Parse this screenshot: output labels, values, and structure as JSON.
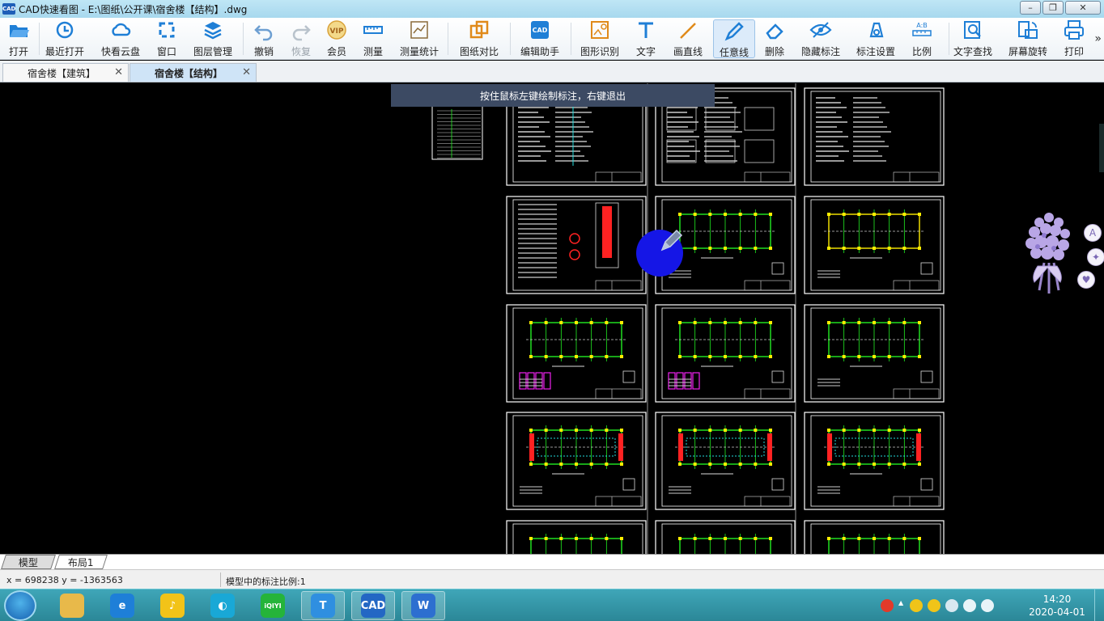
{
  "window": {
    "app_icon": "CAD",
    "title": "CAD快速看图 - E:\\图纸\\公开课\\宿舍楼【结构】.dwg",
    "controls": [
      "minimize",
      "maximize",
      "close"
    ]
  },
  "toolbar": {
    "items": [
      {
        "label": "打开",
        "icon": "folder-open-icon"
      },
      {
        "label": "最近打开",
        "icon": "recent-clock-icon"
      },
      {
        "label": "快看云盘",
        "icon": "cloud-icon"
      },
      {
        "label": "窗口",
        "icon": "window-frame-icon"
      },
      {
        "label": "图层管理",
        "icon": "layers-icon"
      },
      {
        "label": "撤销",
        "icon": "undo-icon"
      },
      {
        "label": "恢复",
        "icon": "redo-icon"
      },
      {
        "label": "会员",
        "icon": "vip-icon"
      },
      {
        "label": "测量",
        "icon": "ruler-icon"
      },
      {
        "label": "测量统计",
        "icon": "measure-stats-icon"
      },
      {
        "label": "图纸对比",
        "icon": "compare-icon"
      },
      {
        "label": "编辑助手",
        "icon": "edit-assistant-icon"
      },
      {
        "label": "图形识别",
        "icon": "shape-recognize-icon"
      },
      {
        "label": "文字",
        "icon": "text-icon"
      },
      {
        "label": "画直线",
        "icon": "line-icon"
      },
      {
        "label": "任意线",
        "icon": "freehand-pen-icon"
      },
      {
        "label": "删除",
        "icon": "eraser-icon"
      },
      {
        "label": "隐藏标注",
        "icon": "hide-eye-icon"
      },
      {
        "label": "标注设置",
        "icon": "annotation-settings-icon"
      },
      {
        "label": "比例",
        "icon": "scale-icon"
      },
      {
        "label": "文字查找",
        "icon": "text-search-icon"
      },
      {
        "label": "屏幕旋转",
        "icon": "rotate-screen-icon"
      },
      {
        "label": "打印",
        "icon": "printer-icon"
      }
    ],
    "more": "»",
    "accent": "#1f7fd6"
  },
  "tabs": [
    {
      "label": "宿舍楼【建筑】",
      "active": false
    },
    {
      "label": "宿舍楼【结构】",
      "active": true
    }
  ],
  "canvas": {
    "hint": "按住鼠标左键绘制标注，右键退出",
    "background": "#000000",
    "sheet_colors": {
      "frame": "#ffffff",
      "green": "#22ee22",
      "yellow": "#ffee00",
      "red": "#ff2222",
      "cyan": "#22dddd",
      "magenta": "#ee22ee"
    }
  },
  "side_tools": [
    "font-a-icon",
    "sparkle-icon",
    "pet-icon"
  ],
  "layout_tabs": [
    "模型",
    "布局1"
  ],
  "status": {
    "coords": "x = 698238  y = -1363563",
    "scale": "模型中的标注比例:1"
  },
  "taskbar": {
    "apps": [
      {
        "name": "file-explorer-icon",
        "glyph": "",
        "color": "#e8b94a",
        "running": false
      },
      {
        "name": "ie-browser-icon",
        "glyph": "e",
        "color": "#1e7fd8",
        "running": false
      },
      {
        "name": "music-app-icon",
        "glyph": "♪",
        "color": "#f2c318",
        "running": false
      },
      {
        "name": "chat-app-icon",
        "glyph": "◐",
        "color": "#19a8d6",
        "running": false
      },
      {
        "name": "iqiyi-icon",
        "glyph": "iQIYI",
        "color": "#25b43a",
        "running": false
      },
      {
        "name": "text-tool-icon",
        "glyph": "T",
        "color": "#2f8fe0",
        "running": true
      },
      {
        "name": "cad-viewer-icon",
        "glyph": "CAD",
        "color": "#2367c4",
        "running": true
      },
      {
        "name": "wps-writer-icon",
        "glyph": "W",
        "color": "#2d6fd0",
        "running": true
      }
    ],
    "tray": [
      "sogou-input-icon",
      "tray-arrow-icon",
      "qq-icon",
      "qq-icon-2",
      "security-icon",
      "volume-icon",
      "network-icon"
    ],
    "time": "14:20",
    "date": "2020-04-01"
  }
}
